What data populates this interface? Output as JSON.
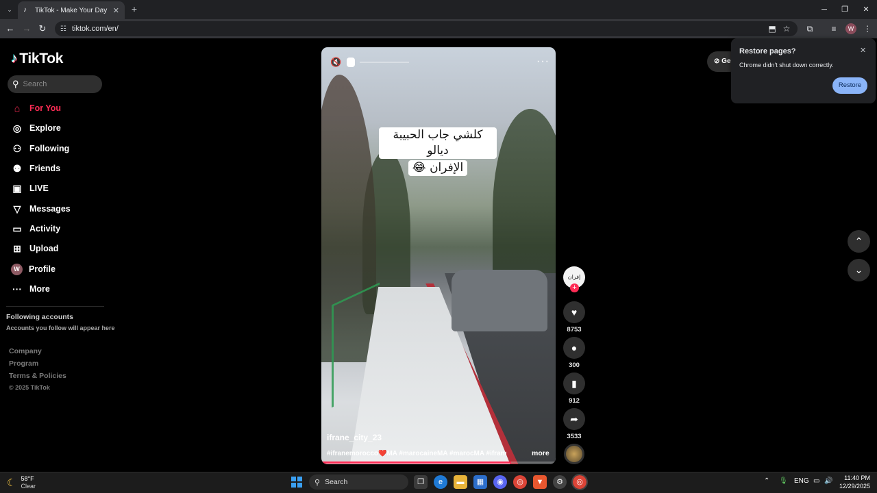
{
  "browser": {
    "tab_title": "TikTok - Make Your Day",
    "url": "tiktok.com/en/",
    "profile_initial": "W"
  },
  "sidebar": {
    "logo_text": "TikTok",
    "search_placeholder": "Search",
    "items": [
      {
        "label": "For You",
        "icon": "home-icon",
        "active": true
      },
      {
        "label": "Explore",
        "icon": "compass-icon"
      },
      {
        "label": "Following",
        "icon": "person-follow-icon"
      },
      {
        "label": "Friends",
        "icon": "friends-icon"
      },
      {
        "label": "LIVE",
        "icon": "live-icon"
      },
      {
        "label": "Messages",
        "icon": "send-icon"
      },
      {
        "label": "Activity",
        "icon": "activity-icon"
      },
      {
        "label": "Upload",
        "icon": "plus-square-icon"
      },
      {
        "label": "Profile",
        "icon": "avatar"
      },
      {
        "label": "More",
        "icon": "more-icon"
      }
    ],
    "profile_initial": "W",
    "following_accounts_title": "Following accounts",
    "following_accounts_sub": "Accounts you follow will appear here",
    "footer_links": [
      "Company",
      "Program",
      "Terms & Policies"
    ],
    "copyright": "© 2025 TikTok"
  },
  "video": {
    "caption_line1": "كلشي جاب الحبيبة ديالو",
    "caption_line2": "الإفران 😂",
    "username": "ifrane_city_23",
    "hashtags": "#ifranemorocco❤️MA #marocaineMA #marocMA #ifraneMA ...",
    "more_label": "more",
    "creator_avatar_text": "إفران",
    "progress": 0.81
  },
  "actions": {
    "likes": "8753",
    "comments": "300",
    "saves": "912",
    "shares": "3533"
  },
  "get_app_label": "Ge",
  "restore_popup": {
    "title": "Restore pages?",
    "message": "Chrome didn't shut down correctly.",
    "button": "Restore"
  },
  "taskbar": {
    "temperature": "58°F",
    "condition": "Clear",
    "search_label": "Search",
    "language": "ENG",
    "time": "11:40 PM",
    "date": "12/29/2025"
  }
}
